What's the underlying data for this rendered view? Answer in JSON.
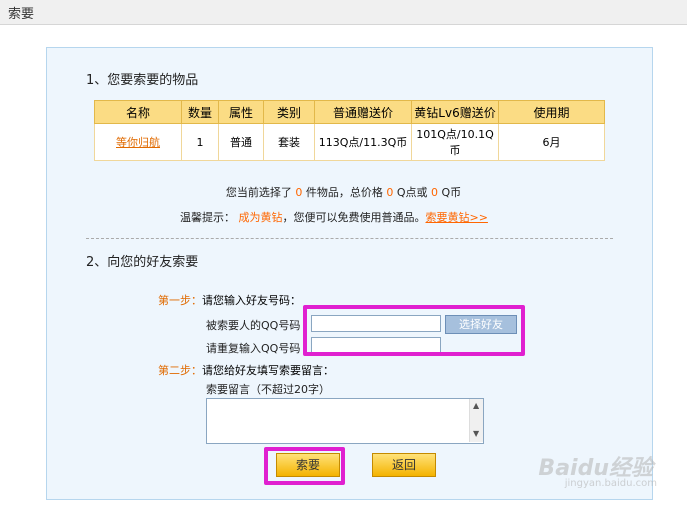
{
  "window": {
    "title": "索要"
  },
  "section1": {
    "title": "1、您要索要的物品",
    "table": {
      "headers": [
        "名称",
        "数量",
        "属性",
        "类别",
        "普通赠送价",
        "黄钻Lv6赠送价",
        "使用期"
      ],
      "rows": [
        [
          "等你归航",
          "1",
          "普通",
          "套装",
          "113Q点/11.3Q币",
          "101Q点/10.1Q币",
          "6月"
        ]
      ]
    },
    "summary": {
      "prefix": "您当前选择了",
      "count": "0",
      "mid1": "件物品，总价格",
      "qpoints": "0",
      "mid2": "Q点或",
      "qcoins": "0",
      "suffix": "Q币"
    },
    "hint": {
      "prefix": "温馨提示：",
      "link1": "成为黄钻",
      "mid": "，您便可以免费使用普通品。",
      "link2": "索要黄钻>>"
    }
  },
  "section2": {
    "title": "2、向您的好友索要",
    "step1": {
      "label": "第一步：",
      "text": "请您输入好友号码："
    },
    "qq_label": "被索要人的QQ号码",
    "qq_value": "",
    "qq_repeat_label": "请重复输入QQ号码",
    "qq_repeat_value": "",
    "pick_friend": "选择好友",
    "step2": {
      "label": "第二步：",
      "text": "请您给好友填写索要留言："
    },
    "message_label": "索要留言（不超过20字）",
    "message_value": ""
  },
  "buttons": {
    "request": "索要",
    "back": "返回"
  },
  "watermark": {
    "brand": "Baidu经验",
    "url": "jingyan.baidu.com"
  }
}
